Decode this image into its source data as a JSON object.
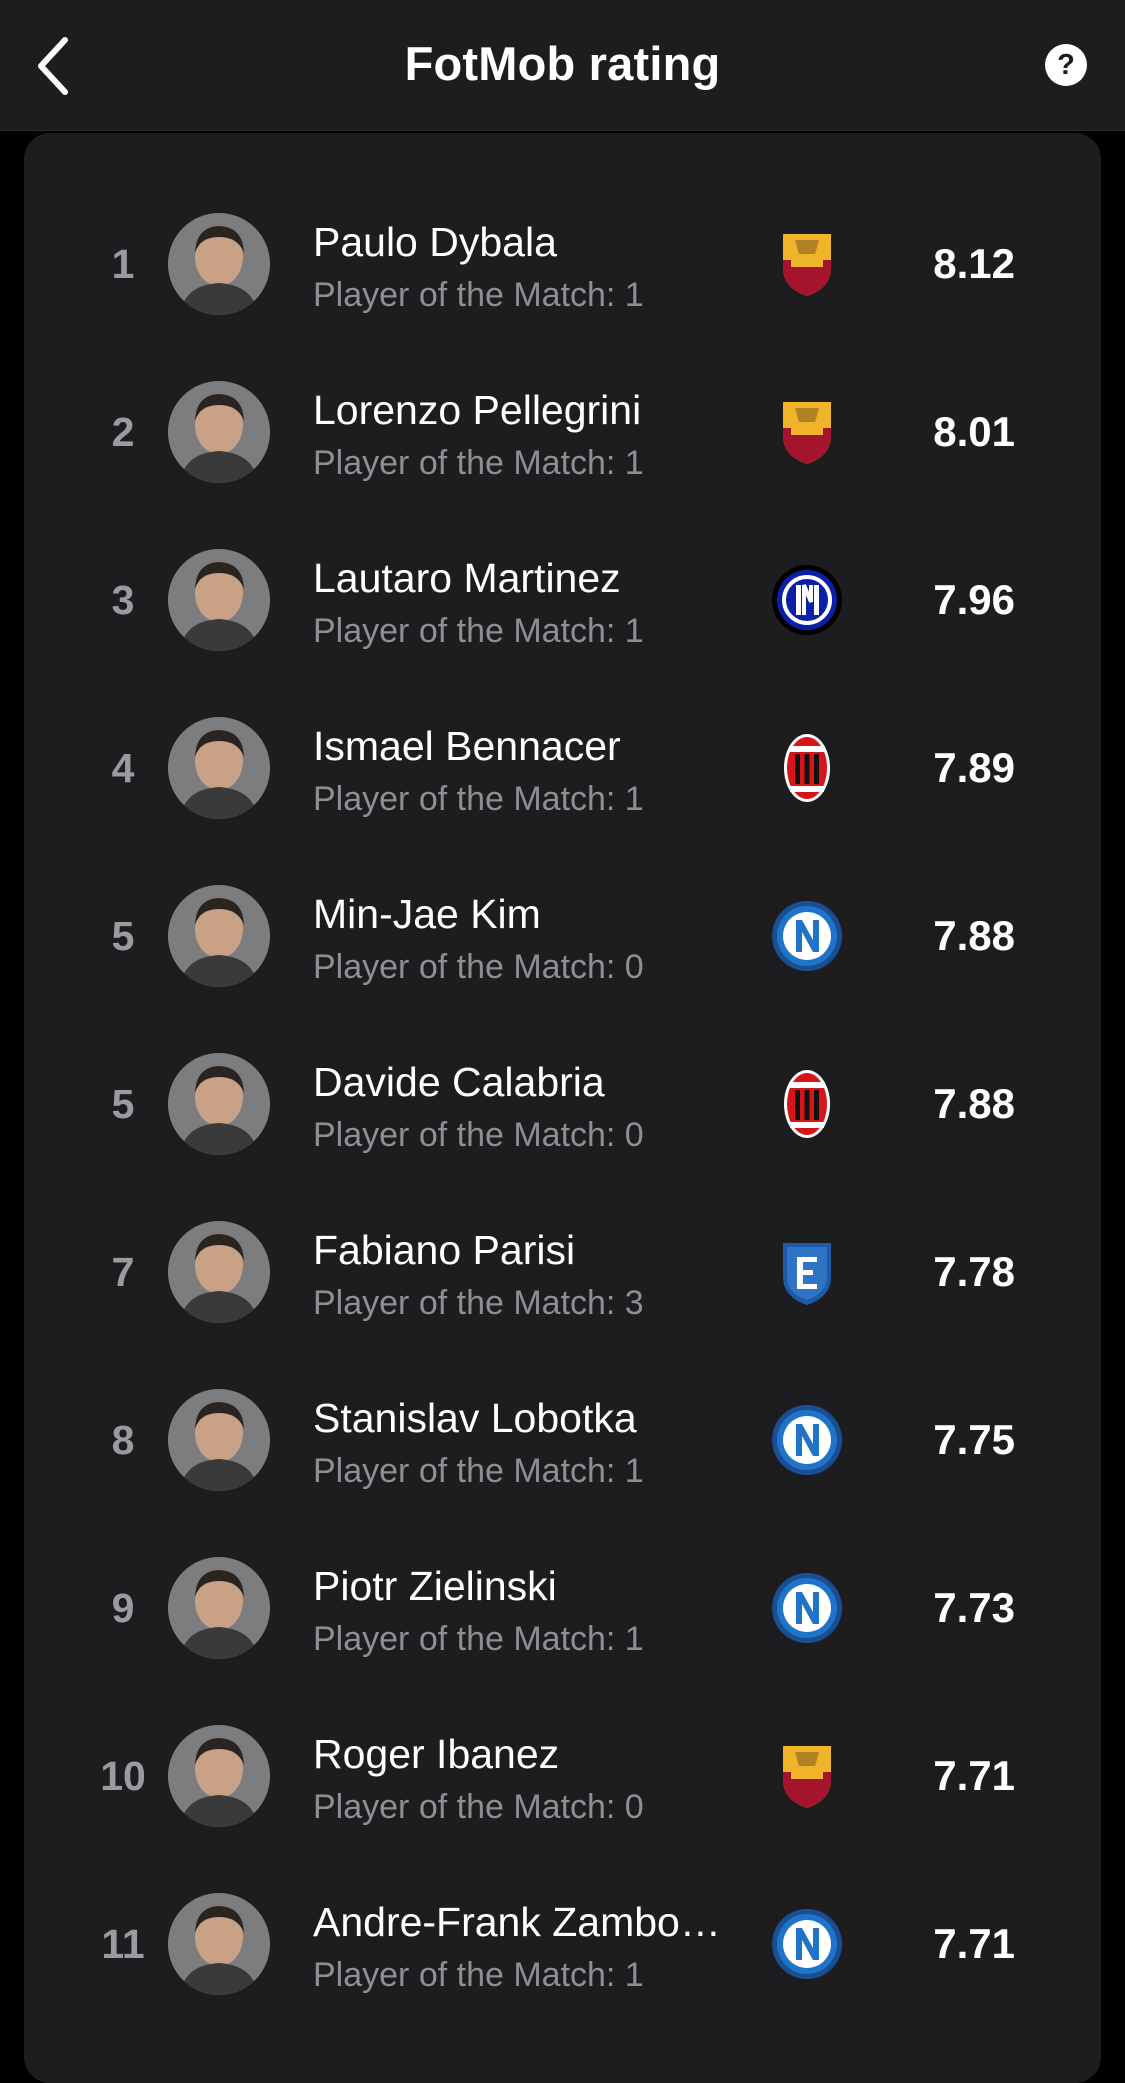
{
  "header": {
    "title": "FotMob rating",
    "help_label": "?"
  },
  "rows": [
    {
      "rank": "1",
      "name": "Paulo Dybala",
      "potm": "Player of the Match: 1",
      "rating": "8.12",
      "club": "roma-crest-icon"
    },
    {
      "rank": "2",
      "name": "Lorenzo Pellegrini",
      "potm": "Player of the Match: 1",
      "rating": "8.01",
      "club": "roma-crest-icon"
    },
    {
      "rank": "3",
      "name": "Lautaro Martinez",
      "potm": "Player of the Match: 1",
      "rating": "7.96",
      "club": "inter-crest-icon"
    },
    {
      "rank": "4",
      "name": "Ismael Bennacer",
      "potm": "Player of the Match: 1",
      "rating": "7.89",
      "club": "milan-crest-icon"
    },
    {
      "rank": "5",
      "name": "Min-Jae Kim",
      "potm": "Player of the Match: 0",
      "rating": "7.88",
      "club": "napoli-crest-icon"
    },
    {
      "rank": "5",
      "name": "Davide Calabria",
      "potm": "Player of the Match: 0",
      "rating": "7.88",
      "club": "milan-crest-icon"
    },
    {
      "rank": "7",
      "name": "Fabiano Parisi",
      "potm": "Player of the Match: 3",
      "rating": "7.78",
      "club": "empoli-crest-icon"
    },
    {
      "rank": "8",
      "name": "Stanislav Lobotka",
      "potm": "Player of the Match: 1",
      "rating": "7.75",
      "club": "napoli-crest-icon"
    },
    {
      "rank": "9",
      "name": "Piotr Zielinski",
      "potm": "Player of the Match: 1",
      "rating": "7.73",
      "club": "napoli-crest-icon"
    },
    {
      "rank": "10",
      "name": "Roger Ibanez",
      "potm": "Player of the Match: 0",
      "rating": "7.71",
      "club": "roma-crest-icon"
    },
    {
      "rank": "11",
      "name": "Andre-Frank Zambo…",
      "potm": "Player of the Match: 1",
      "rating": "7.71",
      "club": "napoli-crest-icon"
    }
  ],
  "colors": {
    "background": "#000000",
    "surface": "#1d1d1f",
    "text_primary": "#ffffff",
    "text_secondary": "#8e8e93",
    "rank_text": "#9a9a9f"
  }
}
